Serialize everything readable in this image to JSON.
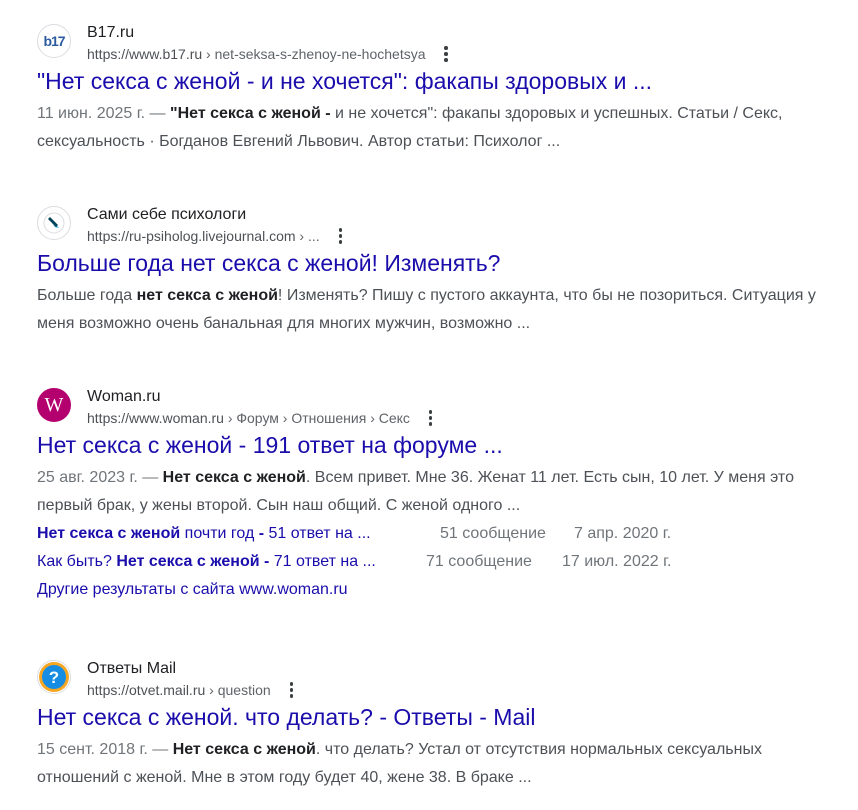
{
  "results": [
    {
      "site_name": "B17.ru",
      "url": "https://www.b17.ru",
      "breadcrumb": " › net-seksa-s-zhenoy-ne-hochetsya",
      "favicon_text": "b17",
      "title": "\"Нет секса с женой - и не хочется\": факапы здоровых и ...",
      "date": "11 июн. 2025 г. — ",
      "snippet_bold1": "\"Нет секса с женой -",
      "snippet_rest1": " и не хочется\": факапы здоровых и успешных. Статьи / Секс, сексуальность · Богданов Евгений Львович. Автор статьи: Психолог ..."
    },
    {
      "site_name": "Сами себе психологи",
      "url": "https://ru-psiholog.livejournal.com",
      "breadcrumb": " › ...",
      "title": "Больше года нет секса с женой! Изменять?",
      "snippet_pre": "Больше года ",
      "snippet_bold1": "нет секса с женой",
      "snippet_rest1": "! Изменять? Пишу с пустого аккаунта, что бы не позориться. Ситуация у меня возможно очень банальная для многих мужчин, возможно ..."
    },
    {
      "site_name": "Woman.ru",
      "url": "https://www.woman.ru",
      "breadcrumb": " › Форум › Отношения › Секс",
      "favicon_text": "W",
      "title": "Нет секса с женой - 191 ответ на форуме ...",
      "date": "25 авг. 2023 г. — ",
      "snippet_bold1": "Нет секса с женой",
      "snippet_rest1": ". Всем привет. Мне 36. Женат 11 лет. Есть сын, 10 лет. У меня это первый брак, у жены второй. Сын наш общий. С женой одного ...",
      "sublinks": [
        {
          "pre": "",
          "bold": "Нет секса с женой",
          "mid": " почти год ",
          "bold2": "-",
          "post": " 51 ответ на ...",
          "count": "51 сообщение",
          "date": "7 апр. 2020 г."
        },
        {
          "pre": "Как быть? ",
          "bold": "Нет секса с женой -",
          "mid": "",
          "bold2": "",
          "post": " 71 ответ на ...",
          "count": "71 сообщение",
          "date": "17 июл. 2022 г."
        }
      ],
      "more": "Другие результаты с сайта www.woman.ru"
    },
    {
      "site_name": "Ответы Mail",
      "url": "https://otvet.mail.ru",
      "breadcrumb": " › question",
      "favicon_text": "?",
      "title": "Нет секса с женой. что делать? - Ответы - Mail",
      "date": "15 сент. 2018 г. — ",
      "snippet_bold1": "Нет секса с женой",
      "snippet_rest1": ". что делать? Устал от отсутствия нормальных сексуальных отношений с женой. Мне в этом году будет 40, жене 38. В браке ..."
    }
  ],
  "colors": {
    "link": "#1a0dab",
    "text": "#202124",
    "snippet": "#4d5156",
    "meta": "#70757a"
  }
}
